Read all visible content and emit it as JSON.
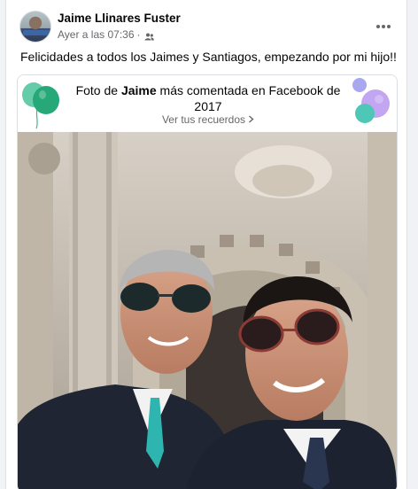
{
  "post": {
    "author": "Jaime Llinares Fuster",
    "timestamp": "Ayer a las 07:36",
    "separator": "·",
    "text": "Felicidades a todos los Jaimes y Santiagos, empezando por mi hijo!!"
  },
  "memory": {
    "title_prefix": "Foto de ",
    "title_name": "Jaime",
    "title_suffix": " más comentada en Facebook de 2017",
    "link_label": "Ver tus recuerdos"
  },
  "icons": {
    "audience": "friends-icon",
    "more": "more-options-icon",
    "link_chevron": "chevron-right-icon",
    "balloons_left": "balloons-icon",
    "balloons_right": "balloons-icon"
  },
  "colors": {
    "name_text": "#050505",
    "meta_text": "#65676b",
    "balloon_green": "#3cb98a",
    "balloon_purple": "#b79cf2",
    "balloon_teal": "#52c7b8"
  }
}
